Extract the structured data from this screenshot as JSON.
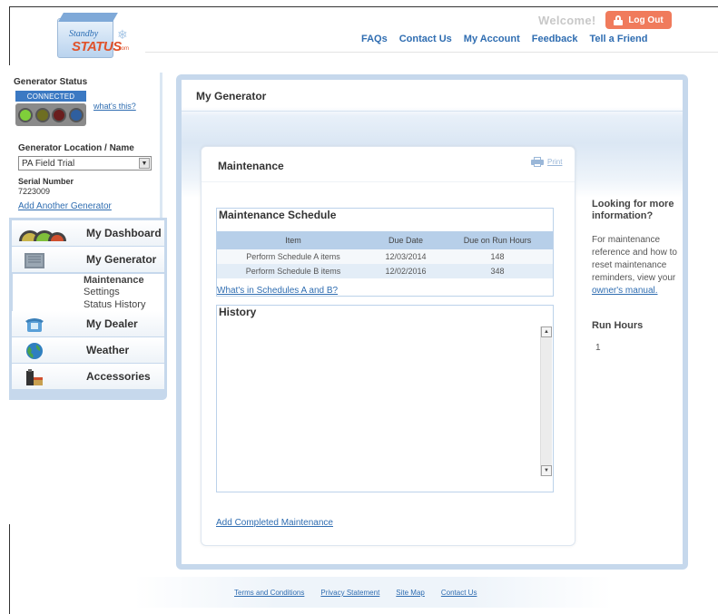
{
  "brand": {
    "logo_line1": "Standby",
    "logo_line2": "STATUS",
    "logo_suffix": ".com"
  },
  "header": {
    "welcome": "Welcome!",
    "logout_label": "Log Out",
    "nav": [
      "FAQs",
      "Contact Us",
      "My Account",
      "Feedback",
      "Tell a Friend"
    ]
  },
  "status_panel": {
    "title": "Generator Status",
    "connection": "CONNECTED",
    "whats_this": "what's this?",
    "lights": [
      "#7fcf3a",
      "#9a9a2a",
      "#8a2424",
      "#2f5f9f"
    ]
  },
  "location": {
    "label": "Generator Location / Name",
    "selected": "PA Field Trial",
    "serial_label": "Serial Number",
    "serial_value": "7223009",
    "add_link": "Add Another Generator"
  },
  "nav": {
    "dashboard": "My Dashboard",
    "generator": "My Generator",
    "sub": [
      "Maintenance",
      "Settings",
      "Status History"
    ],
    "dealer": "My Dealer",
    "weather": "Weather",
    "accessories": "Accessories"
  },
  "main": {
    "title": "My Generator",
    "card_title": "Maintenance",
    "print": "Print",
    "schedule": {
      "title": "Maintenance Schedule",
      "headers": [
        "Item",
        "Due Date",
        "Due on Run Hours"
      ],
      "rows": [
        [
          "Perform Schedule A items",
          "12/03/2014",
          "148"
        ],
        [
          "Perform Schedule B items",
          "12/02/2016",
          "348"
        ]
      ],
      "link": "What's in Schedules A and B?"
    },
    "history_title": "History",
    "add_link": "Add Completed Maintenance"
  },
  "sidebar_info": {
    "title": "Looking for more information?",
    "text": "For maintenance reference and how to reset maintenance reminders, view your",
    "manual_link": "owner's manual.",
    "run_hours_title": "Run Hours",
    "run_hours_value": "1"
  },
  "footer": {
    "links": [
      "Terms and Conditions",
      "Privacy Statement",
      "Site Map",
      "Contact Us"
    ]
  }
}
